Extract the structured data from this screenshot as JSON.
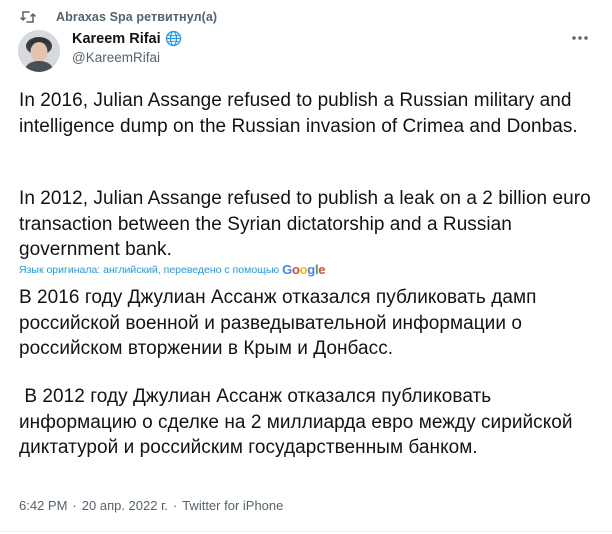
{
  "retweet": {
    "icon": "retweet-icon",
    "text": "Abraxas Spa ретвитнул(а)"
  },
  "author": {
    "name": "Kareem Rifai",
    "handle": "@KareemRifai",
    "badge_icon": "globe-icon"
  },
  "more_icon": "more-horizontal-icon",
  "original": {
    "paragraph1": "In 2016, Julian Assange refused to publish a Russian military and intelligence dump on the Russian invasion of Crimea and Donbas.",
    "paragraph2": "In 2012, Julian Assange refused to publish a leak on a 2 billion euro transaction between the Syrian dictatorship and a Russian government bank."
  },
  "translation": {
    "note": "Язык оригинала: английский, переведено с помощью",
    "provider": "Google",
    "paragraph1": "В 2016 году Джулиан Ассанж отказался публиковать дамп российской военной и разведывательной информации о российском вторжении в Крым и Донбасс.",
    "paragraph2": " В 2012 году Джулиан Ассанж отказался публиковать информацию о сделке на 2 миллиарда евро между сирийской диктатурой и российским государственным банком."
  },
  "meta": {
    "time": "6:42 PM",
    "separator": "·",
    "date": "20 апр. 2022 г.",
    "source": "Twitter for iPhone"
  },
  "colors": {
    "text": "#0f1419",
    "secondary": "#536471",
    "link": "#1d9bf0"
  }
}
